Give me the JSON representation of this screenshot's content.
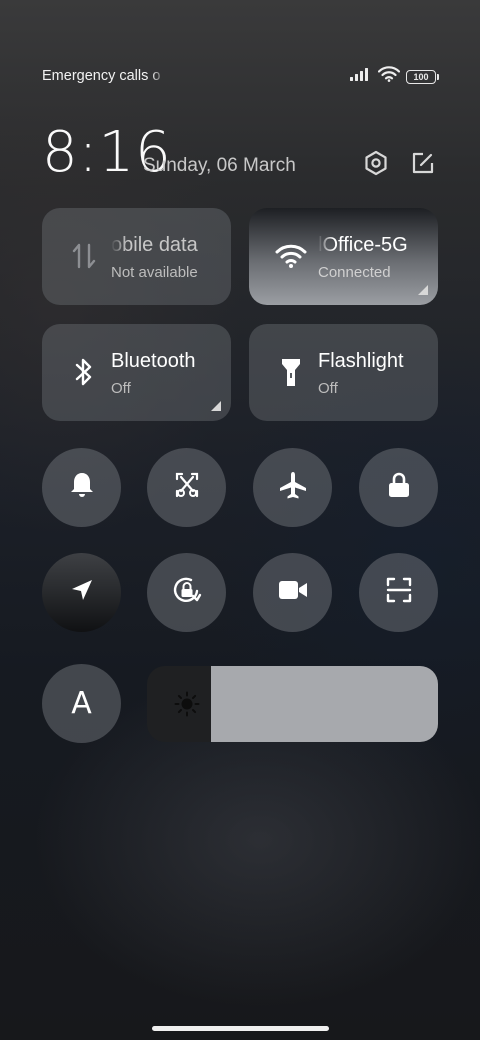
{
  "status_bar": {
    "carrier_text": "Emergency calls o",
    "battery_level": "100"
  },
  "header": {
    "time": "8:16",
    "date": "Sunday, 06 March",
    "settings_icon": "settings-hexagon-icon",
    "edit_icon": "edit-icon"
  },
  "tiles": {
    "mobile_data": {
      "title": "obile data",
      "status": "Not available",
      "enabled": false,
      "icon": "mobile-data-arrows-icon"
    },
    "wifi": {
      "title": "lOffice-5G",
      "status": "Connected",
      "enabled": true,
      "icon": "wifi-icon"
    },
    "bluetooth": {
      "title": "Bluetooth",
      "status": "Off",
      "enabled": false,
      "icon": "bluetooth-icon"
    },
    "flashlight": {
      "title": "Flashlight",
      "status": "Off",
      "enabled": false,
      "icon": "flashlight-icon"
    }
  },
  "toggles": [
    {
      "name": "ringer",
      "icon": "bell-icon",
      "active": false
    },
    {
      "name": "screenshot",
      "icon": "screenshot-scissors-icon",
      "active": false
    },
    {
      "name": "airplane-mode",
      "icon": "airplane-icon",
      "active": false
    },
    {
      "name": "lock-screen",
      "icon": "lock-icon",
      "active": false
    },
    {
      "name": "location",
      "icon": "location-arrow-icon",
      "active": true
    },
    {
      "name": "rotation-lock",
      "icon": "rotation-lock-icon",
      "active": false
    },
    {
      "name": "screen-recorder",
      "icon": "video-camera-icon",
      "active": false
    },
    {
      "name": "scanner",
      "icon": "scan-frame-icon",
      "active": false
    }
  ],
  "auto_brightness": {
    "label": "A",
    "active": false
  },
  "brightness": {
    "level": 0.78,
    "icon": "sun-icon"
  },
  "colors": {
    "tile_bg": "#6e7278",
    "slider_fill": "#a7a9ad",
    "slider_track": "#1f2022"
  }
}
